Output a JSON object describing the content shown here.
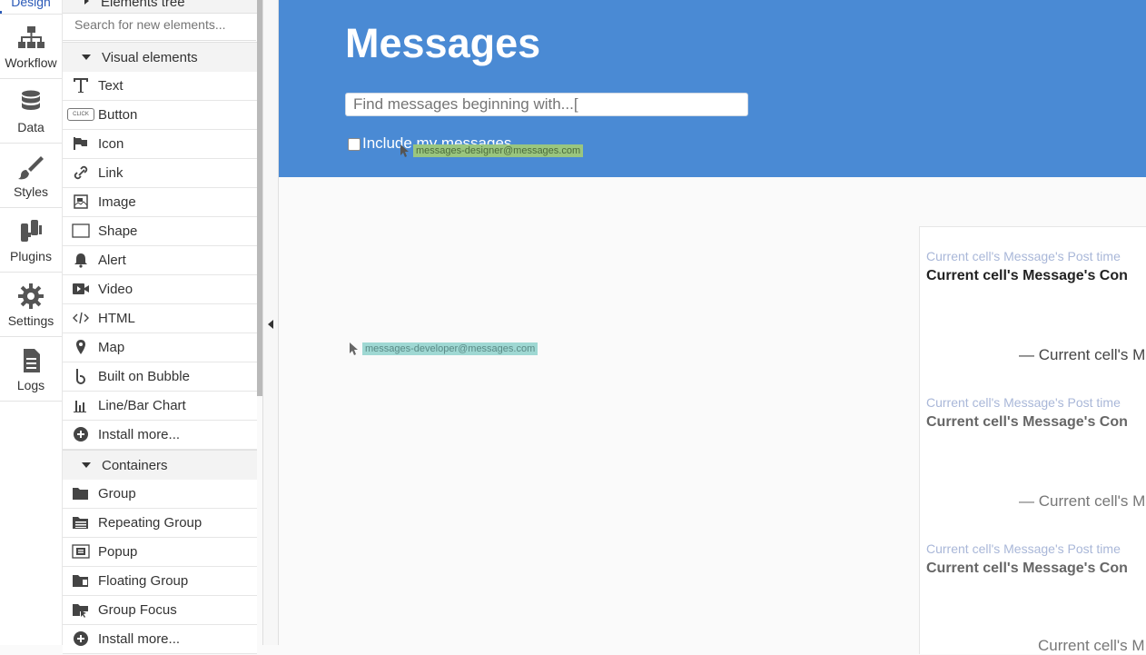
{
  "tabs": [
    {
      "label": "Design",
      "icon": "design-icon",
      "active": true
    },
    {
      "label": "Workflow",
      "icon": "workflow-icon"
    },
    {
      "label": "Data",
      "icon": "database-icon"
    },
    {
      "label": "Styles",
      "icon": "brush-icon"
    },
    {
      "label": "Plugins",
      "icon": "plugin-icon"
    },
    {
      "label": "Settings",
      "icon": "gear-icon"
    },
    {
      "label": "Logs",
      "icon": "logs-icon"
    }
  ],
  "panel": {
    "tree_label": "Elements tree",
    "search_placeholder": "Search for new elements...",
    "visual_section": "Visual elements",
    "visual_items": [
      {
        "label": "Text",
        "icon": "text-icon"
      },
      {
        "label": "Button",
        "icon": "button-icon"
      },
      {
        "label": "Icon",
        "icon": "flag-icon"
      },
      {
        "label": "Link",
        "icon": "link-icon"
      },
      {
        "label": "Image",
        "icon": "image-icon"
      },
      {
        "label": "Shape",
        "icon": "shape-icon"
      },
      {
        "label": "Alert",
        "icon": "bell-icon"
      },
      {
        "label": "Video",
        "icon": "video-icon"
      },
      {
        "label": "HTML",
        "icon": "code-icon"
      },
      {
        "label": "Map",
        "icon": "map-pin-icon"
      },
      {
        "label": "Built on Bubble",
        "icon": "bubble-logo-icon"
      },
      {
        "label": "Line/Bar Chart",
        "icon": "bar-chart-icon"
      },
      {
        "label": "Install more...",
        "icon": "plus-circle-icon"
      }
    ],
    "containers_section": "Containers",
    "container_items": [
      {
        "label": "Group",
        "icon": "folder-icon"
      },
      {
        "label": "Repeating Group",
        "icon": "repeating-group-icon"
      },
      {
        "label": "Popup",
        "icon": "popup-icon"
      },
      {
        "label": "Floating Group",
        "icon": "floating-group-icon"
      },
      {
        "label": "Group Focus",
        "icon": "group-focus-icon"
      },
      {
        "label": "Install more...",
        "icon": "plus-circle-icon"
      }
    ],
    "button_icon_text": "CLICK"
  },
  "canvas": {
    "title": "Messages",
    "search_placeholder": "Find messages beginning with...[",
    "checkbox_label": "Include my messages",
    "cursor_tags": {
      "designer": "messages-designer@messages.com",
      "developer": "messages-developer@messages.com"
    },
    "cells": [
      {
        "time": "Current cell's Message's Post time",
        "content": "Current cell's Message's Con",
        "author": "— Current cell's M"
      },
      {
        "time": "Current cell's Message's Post time",
        "content": "Current cell's Message's Con",
        "author": "— Current cell's M"
      },
      {
        "time": "Current cell's Message's Post time",
        "content": "Current cell's Message's Con",
        "author": "Current cell's M"
      }
    ]
  },
  "colors": {
    "hero_bg": "#4a8ad4",
    "active_tab": "#2b5ab8",
    "post_time": "#a9b7d8",
    "designer_tag": "#9ac67f",
    "developer_tag": "#9fd8d3"
  }
}
